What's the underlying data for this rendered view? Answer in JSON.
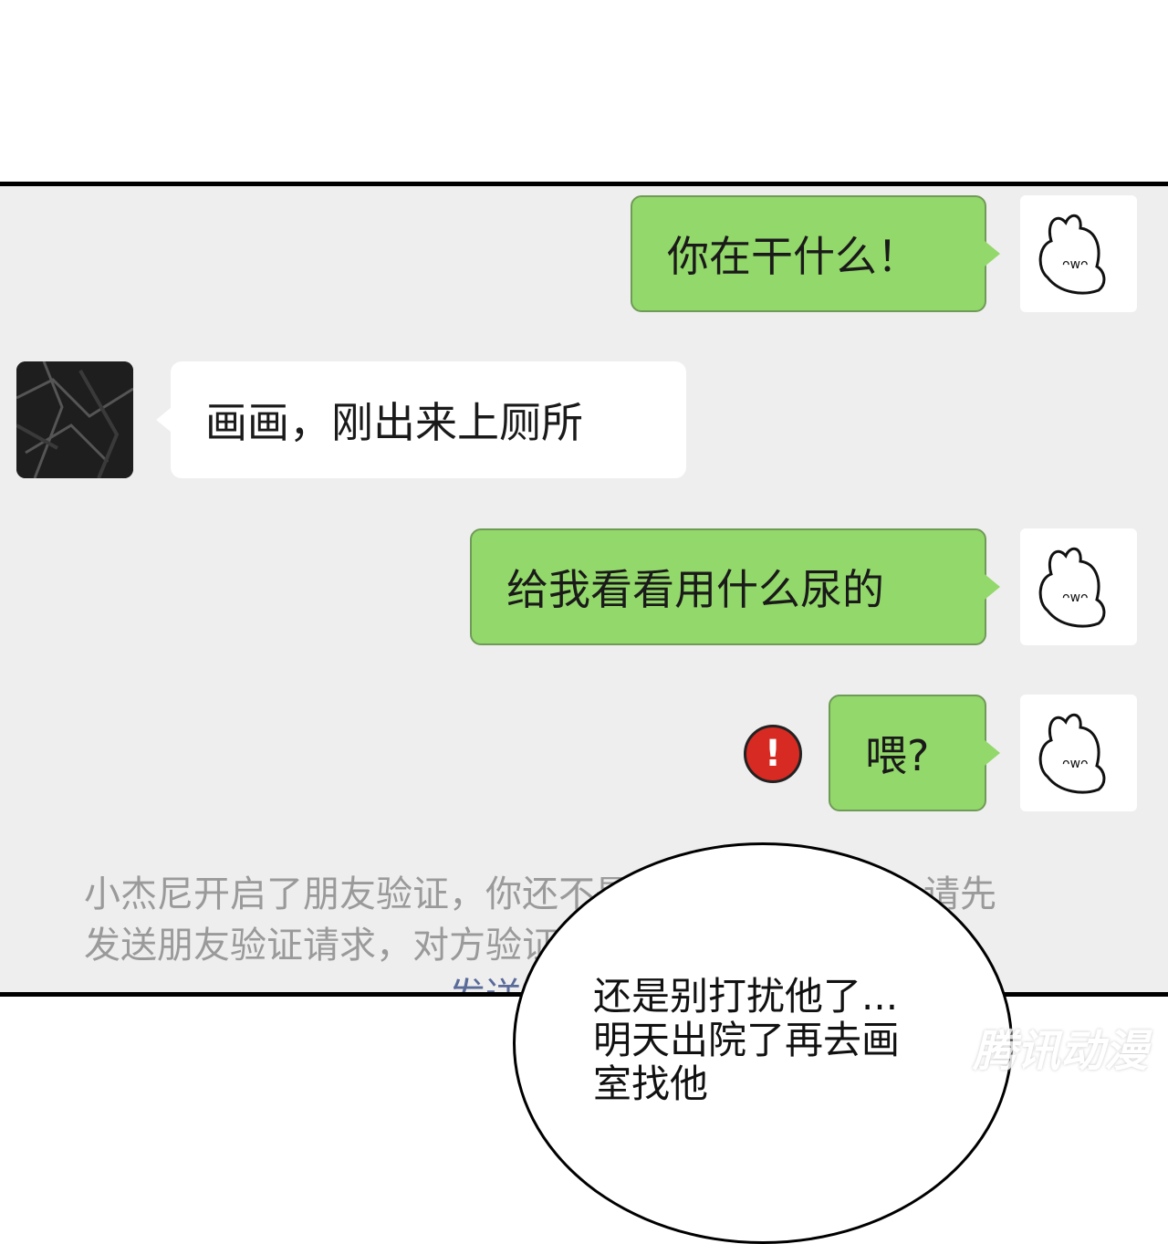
{
  "messages": [
    {
      "side": "right",
      "text": "你在干什么！"
    },
    {
      "side": "left",
      "text": "画画，刚出来上厕所"
    },
    {
      "side": "right",
      "text": "给我看看用什么尿的"
    },
    {
      "side": "right",
      "text": "喂?",
      "status": "!"
    }
  ],
  "system_notice": {
    "line1": "小杰尼开启了朋友验证，你还不是他（她）的朋友。请先",
    "line2": "发送朋友验证请求，对方验证通过后，才能聊天。",
    "link": "发送朋友验证"
  },
  "speech": {
    "line1": "还是别打扰他了...",
    "line2": "明天出院了再去画",
    "line3": "室找他"
  },
  "watermark": "腾讯动漫",
  "colors": {
    "sent_bubble": "#93d86a",
    "received_bubble": "#ffffff",
    "chat_background": "#eeeeee",
    "error": "#d62a23"
  }
}
